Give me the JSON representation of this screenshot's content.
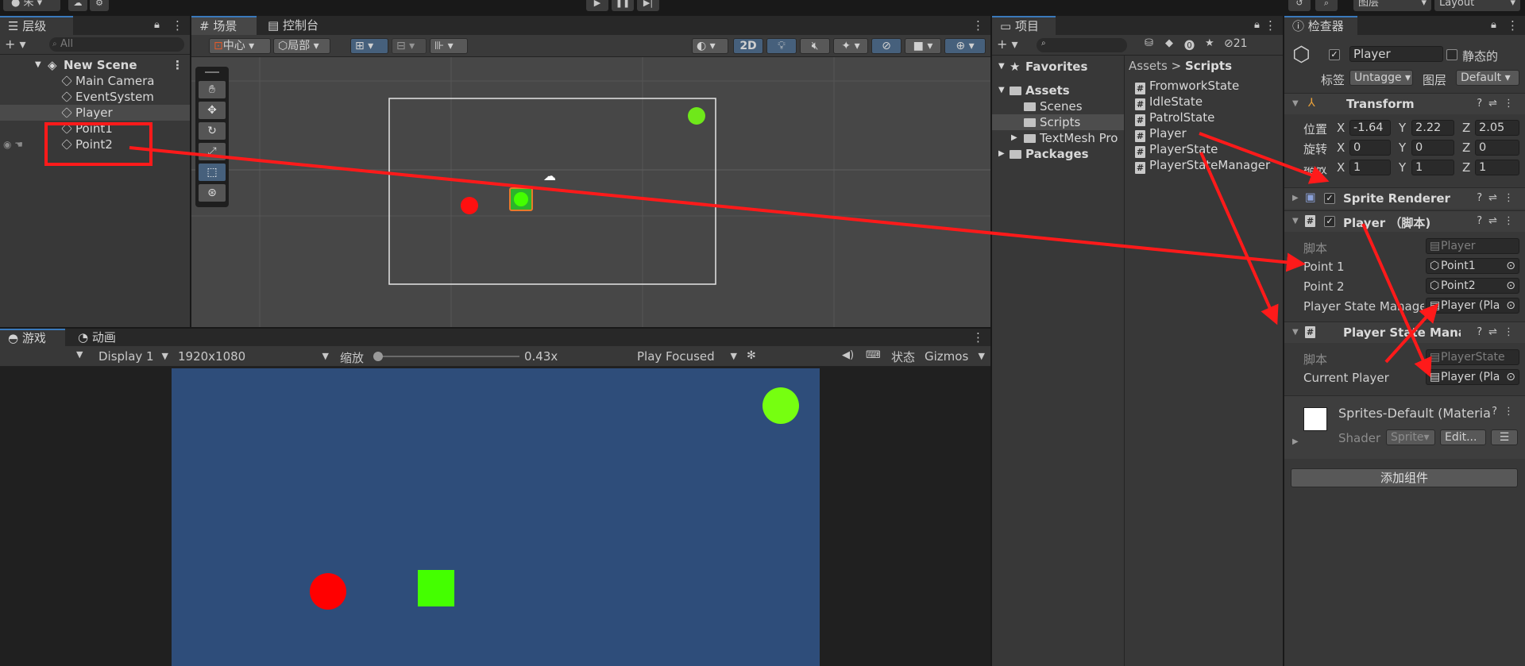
{
  "topbar": {
    "left_user": "朱",
    "layers_menu": "图层",
    "layout_menu": "Layout"
  },
  "hierarchy": {
    "tab": "层级",
    "search_placeholder": "All",
    "scene": "New Scene",
    "items": [
      "Main Camera",
      "EventSystem",
      "Player",
      "Point1",
      "Point2"
    ]
  },
  "scene_view": {
    "tabs": [
      "场景",
      "控制台"
    ],
    "pivot_btn": "中心",
    "space_btn": "局部",
    "mode_2d": "2D"
  },
  "game_view": {
    "tabs": [
      "游戏",
      "动画"
    ],
    "display": "Display 1",
    "resolution": "1920x1080",
    "scale_label": "缩放",
    "scale_value": "0.43x",
    "play_mode": "Play Focused",
    "stats": "状态",
    "gizmos": "Gizmos"
  },
  "project": {
    "tab": "项目",
    "hidden_count": "21",
    "favorites": "Favorites",
    "assets": "Assets",
    "folders": [
      "Scenes",
      "Scripts",
      "TextMesh Pro"
    ],
    "packages": "Packages",
    "breadcrumb": [
      "Assets",
      "Scripts"
    ],
    "files": [
      "FromworkState",
      "IdleState",
      "PatrolState",
      "Player",
      "PlayerState",
      "PlayerStateManager"
    ]
  },
  "inspector": {
    "tab": "检查器",
    "object_name": "Player",
    "static_label": "静态的",
    "tag_label": "标签",
    "tag_value": "Untagge",
    "layer_label": "图层",
    "layer_value": "Default",
    "transform": {
      "title": "Transform",
      "rows": [
        {
          "label": "位置",
          "x": "-1.64",
          "y": "2.22",
          "z": "2.05"
        },
        {
          "label": "旋转",
          "x": "0",
          "y": "0",
          "z": "0"
        },
        {
          "label": "缩放",
          "x": "1",
          "y": "1",
          "z": "1"
        }
      ]
    },
    "sprite_renderer": "Sprite Renderer",
    "player_script": {
      "title": "Player （脚本)",
      "script_label": "脚本",
      "script_value": "Player",
      "point1_label": "Point 1",
      "point1_value": "Point1",
      "point2_label": "Point 2",
      "point2_value": "Point2",
      "psm_label": "Player State Manage",
      "psm_value": "Player (Pla"
    },
    "psm_component": {
      "title": "Player State Manag",
      "script_label": "脚本",
      "script_value": "PlayerState",
      "current_label": "Current Player",
      "current_value": "Player (Pla"
    },
    "material": {
      "name": "Sprites-Default (Materia",
      "shader_label": "Shader",
      "shader_value": "Sprite",
      "edit": "Edit..."
    },
    "add_component": "添加组件"
  },
  "colors": {
    "accent_red": "#ff1a1a",
    "game_bg": "#2e4d7a",
    "green": "#44ff00",
    "lime": "#7aff14",
    "red_obj": "#ff0000"
  }
}
